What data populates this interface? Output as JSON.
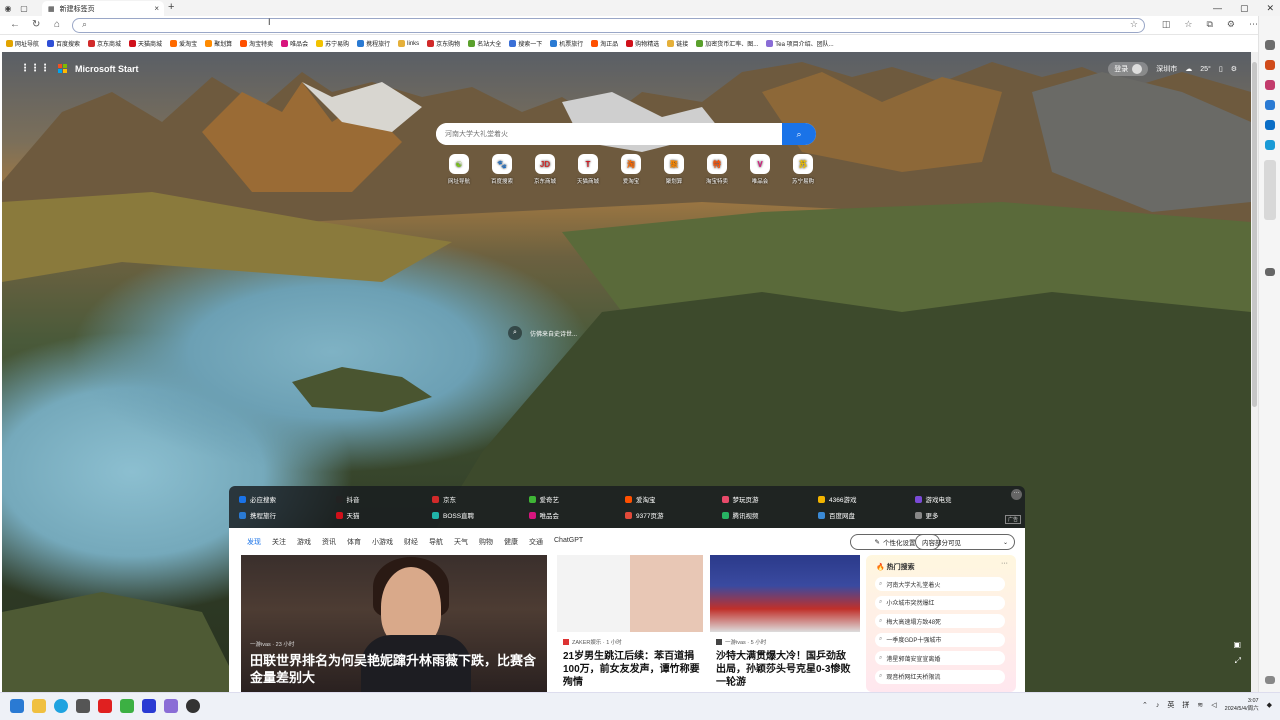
{
  "browser": {
    "tab_title": "新建标签页",
    "address_value": "",
    "close": "×",
    "new_tab": "+"
  },
  "bookmarks": [
    {
      "label": "网址导航",
      "color": "#e2a400"
    },
    {
      "label": "百度搜索",
      "color": "#2f4fd6"
    },
    {
      "label": "京东商城",
      "color": "#d12a2a"
    },
    {
      "label": "天猫商城",
      "color": "#d0101a"
    },
    {
      "label": "爱淘宝",
      "color": "#ff6a00"
    },
    {
      "label": "聚划算",
      "color": "#ff8a00"
    },
    {
      "label": "淘宝特卖",
      "color": "#ff5000"
    },
    {
      "label": "唯品会",
      "color": "#d8157e"
    },
    {
      "label": "苏宁易购",
      "color": "#f2c200"
    },
    {
      "label": "携程旅行",
      "color": "#2a7ad3"
    },
    {
      "label": "links",
      "color": "#e5b03a"
    },
    {
      "label": "京东购物",
      "color": "#d12a2a"
    },
    {
      "label": "名站大全",
      "color": "#5aa02c"
    },
    {
      "label": "搜索一下",
      "color": "#3a6fd6"
    },
    {
      "label": "机票旅行",
      "color": "#2a7ad3"
    },
    {
      "label": "淘正品",
      "color": "#ff5000"
    },
    {
      "label": "购物精选",
      "color": "#d0101a"
    },
    {
      "label": "链接",
      "color": "#e5b03a"
    },
    {
      "label": "加密货币汇率、图...",
      "color": "#5aa02c"
    },
    {
      "label": "Tea 项目介绍、团队...",
      "color": "#8a6dd6"
    }
  ],
  "header": {
    "brand": "Microsoft Start",
    "login": "登录",
    "city": "深圳市",
    "temp": "25°"
  },
  "search": {
    "placeholder": "河南大学大礼堂着火"
  },
  "quick_links": [
    {
      "label": "网址导航",
      "char": "☯",
      "color": "#7bc41e"
    },
    {
      "label": "百度搜索",
      "char": "🐾",
      "color": "#2f4fd6"
    },
    {
      "label": "京东商城",
      "char": "JD",
      "color": "#d12a2a"
    },
    {
      "label": "天猫商城",
      "char": "T",
      "color": "#d0101a"
    },
    {
      "label": "爱淘宝",
      "char": "淘",
      "color": "#ff6a00"
    },
    {
      "label": "聚划算",
      "char": "聚",
      "color": "#ff8a00"
    },
    {
      "label": "淘宝特卖",
      "char": "特",
      "color": "#ff5000"
    },
    {
      "label": "唯品会",
      "char": "V",
      "color": "#d8157e"
    },
    {
      "label": "苏宁易购",
      "char": "苏",
      "color": "#f2c200"
    }
  ],
  "tip": "仿佛来自史诗世...",
  "links_panel": {
    "row1": [
      {
        "label": "必应搜索",
        "color": "#1a73e8"
      },
      {
        "label": "抖音",
        "color": "#222"
      },
      {
        "label": "京东",
        "color": "#d12a2a"
      },
      {
        "label": "爱奇艺",
        "color": "#3fb536"
      },
      {
        "label": "爱淘宝",
        "color": "#ff5000"
      },
      {
        "label": "梦玩页游",
        "color": "#e84a6a"
      },
      {
        "label": "4366游戏",
        "color": "#f2b400"
      },
      {
        "label": "游戏电竞",
        "color": "#7a4ad6"
      }
    ],
    "row2": [
      {
        "label": "携程旅行",
        "color": "#2a7ad3"
      },
      {
        "label": "天猫",
        "color": "#d0101a"
      },
      {
        "label": "BOSS直聘",
        "color": "#20b4a8"
      },
      {
        "label": "唯品会",
        "color": "#d8157e"
      },
      {
        "label": "9377页游",
        "color": "#e24a3a"
      },
      {
        "label": "腾讯视频",
        "color": "#27b463"
      },
      {
        "label": "百度网盘",
        "color": "#3a8ad6"
      },
      {
        "label": "更多",
        "color": "#888"
      }
    ],
    "more": "···",
    "ad": "广告"
  },
  "feed": {
    "tabs": [
      "发现",
      "关注",
      "游戏",
      "资讯",
      "体育",
      "小游戏",
      "财经",
      "导航",
      "天气",
      "购物",
      "健康",
      "交通",
      "ChatGPT"
    ],
    "personalize": "个性化设置",
    "visibility": "内容部分可见",
    "main_source": "一游ivas · 23 小时",
    "main_title": "田联世界排名为何吴艳妮蹿升林雨薇下跌，比赛含金量差别大",
    "card2_source": "ZAKER娱乐 · 1 小时",
    "card2_title": "21岁男生跳江后续：苯百道捐100万，前女友发声，谭竹称要殉情",
    "card3_source": "一游ivas · 5 小时",
    "card3_title": "沙特大满贯爆大冷！国乒劲敌出局，孙颖莎头号克星0-3惨败一轮游",
    "hot_title": "热门搜索",
    "hot_more": "···",
    "hot": [
      "河南大学大礼堂着火",
      "小众城市突然爆红",
      "梅大高速塌方致48死",
      "一季度GDP十强城市",
      "港星郭蔼安宣宣离婚",
      "观音桥网红天桥限流"
    ]
  },
  "taskbar": {
    "ime1": "英",
    "ime2": "拼",
    "time": "3:07",
    "date": "2024/5/4/周六"
  }
}
